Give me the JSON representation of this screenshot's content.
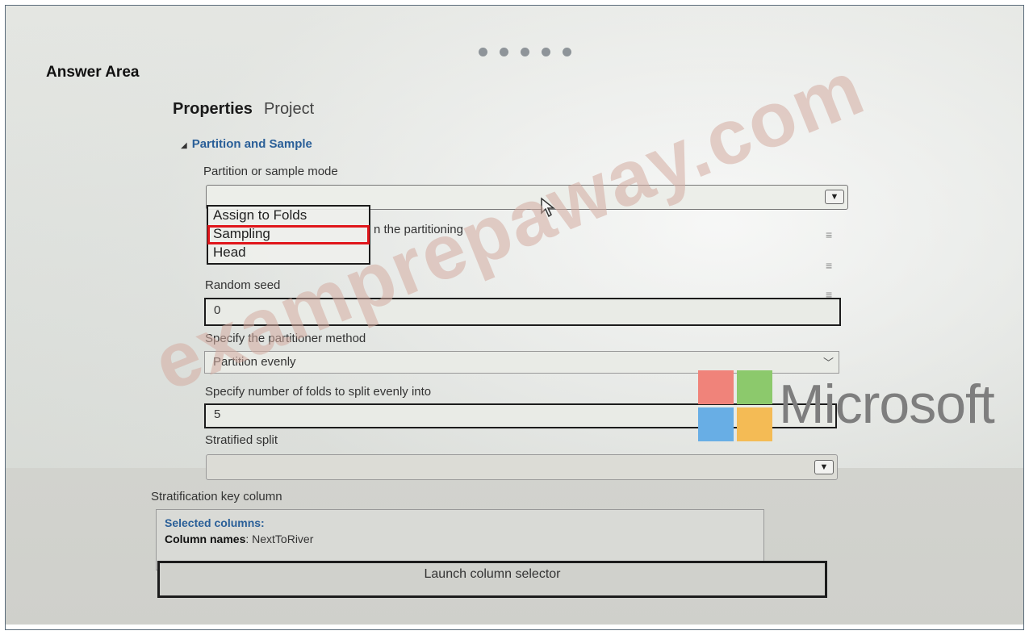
{
  "header": {
    "title": "Answer Area"
  },
  "tabs": [
    {
      "label": "Properties"
    },
    {
      "label": "Project"
    }
  ],
  "section": {
    "title": "Partition and Sample"
  },
  "partition_mode": {
    "label": "Partition or sample mode",
    "value": "",
    "options": [
      "Assign to Folds",
      "Sampling",
      "Head"
    ],
    "highlighted_option": "Sampling",
    "partial_label_tail": "n the partitioning"
  },
  "random_seed": {
    "label": "Random seed",
    "value": "0"
  },
  "partitioner_method": {
    "label": "Specify the partitioner method",
    "value": "Partition evenly"
  },
  "num_folds": {
    "label": "Specify number of folds to split evenly into",
    "value": "5"
  },
  "stratified_split": {
    "label": "Stratified split",
    "value": ""
  },
  "stratification_key": {
    "label": "Stratification key column",
    "selected_label": "Selected columns:",
    "column_names_label": "Column names",
    "column_names_value": ": NextToRiver",
    "launch_button": "Launch column selector"
  },
  "branding": {
    "ms_text": "Microsoft",
    "ms_colors": [
      "#f0837a",
      "#8cc96c",
      "#68aee5",
      "#f4bb55"
    ],
    "watermark": "examprepaway.com"
  },
  "accent": {
    "highlight": "#e0161b",
    "section_title": "#2a5f98"
  }
}
